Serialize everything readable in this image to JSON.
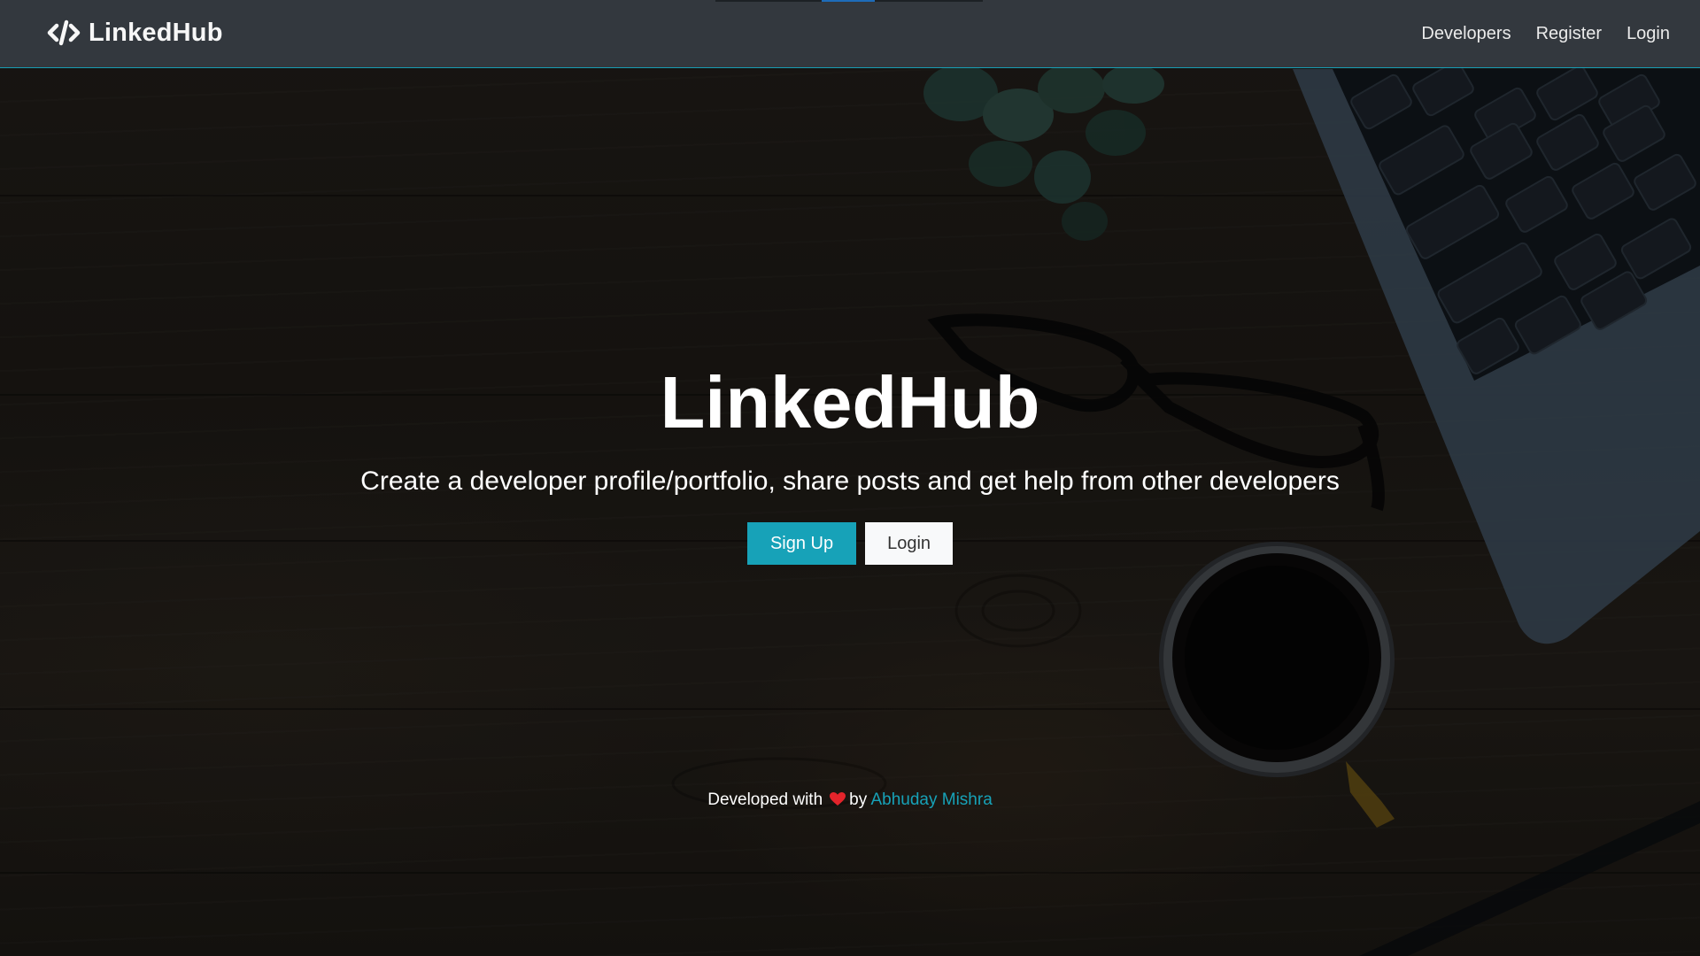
{
  "theme": {
    "navbar_bg": "#343a40",
    "accent": "#17a2b8",
    "light_button_bg": "#f8f9fa",
    "heart_color": "#e3242b"
  },
  "navbar": {
    "brand": {
      "icon": "code-icon",
      "label": "LinkedHub"
    },
    "links": [
      {
        "label": "Developers"
      },
      {
        "label": "Register"
      },
      {
        "label": "Login"
      }
    ]
  },
  "hero": {
    "title": "LinkedHub",
    "lead": "Create a developer profile/portfolio, share posts and get help from other developers",
    "buttons": {
      "signup_label": "Sign Up",
      "login_label": "Login"
    }
  },
  "footer": {
    "prefix": "Developed with",
    "icon": "heart-icon",
    "by": "by",
    "author": "Abhuday Mishra"
  }
}
